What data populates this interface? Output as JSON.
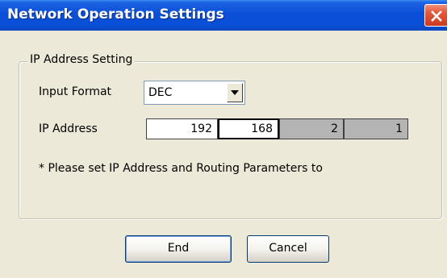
{
  "window": {
    "title": "Network Operation Settings"
  },
  "ip_group": {
    "legend": "IP Address Setting",
    "input_format_label": "Input Format",
    "input_format_value": "DEC",
    "ip_address_label": "IP Address",
    "octets": [
      "192",
      "168",
      "2",
      "1"
    ],
    "note": "* Please set IP Address and Routing Parameters to"
  },
  "buttons": {
    "end_label": "End",
    "cancel_label": "Cancel"
  },
  "icons": {
    "close": "close-icon",
    "dropdown": "chevron-down-icon"
  },
  "colors": {
    "title_bar": "#0a4fd6",
    "close_button": "#d7462a",
    "dialog_background": "#ece9d8",
    "octet_disabled": "#b4b4b4"
  }
}
